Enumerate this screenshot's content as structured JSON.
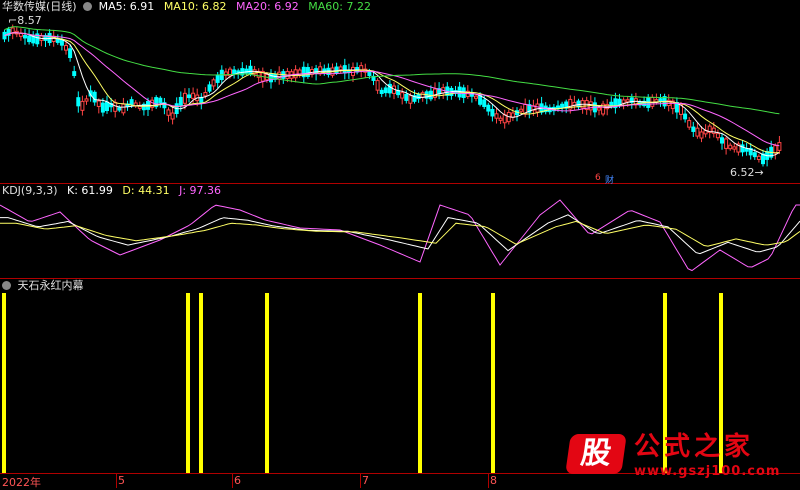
{
  "main_pane": {
    "stock_title": "华数传媒(日线)",
    "ma_legend": [
      {
        "label": "MA5: 6.91",
        "color": "#ffffff"
      },
      {
        "label": "MA10: 6.82",
        "color": "#ffff66"
      },
      {
        "label": "MA20: 6.92",
        "color": "#ff66ff"
      },
      {
        "label": "MA60: 7.22",
        "color": "#44dd44"
      }
    ],
    "high_marker": "8.57",
    "low_marker": "6.52",
    "badges": [
      "6",
      "财"
    ]
  },
  "kdj_pane": {
    "title": "KDJ(9,3,3)",
    "k_label": "K: 61.99",
    "d_label": "D: 44.31",
    "j_label": "J: 97.36"
  },
  "signal_pane": {
    "title": "天石永红内幕",
    "bar_color": "#ffff00"
  },
  "x_axis": {
    "ticks": [
      "2022年",
      "5",
      "6",
      "7",
      "8"
    ]
  },
  "watermark": {
    "logo_char": "股",
    "title": "公式之家",
    "url": "www.gszj100.com"
  },
  "colors": {
    "up": "#ff4444",
    "down": "#00ffff",
    "separator": "#b00000"
  }
}
